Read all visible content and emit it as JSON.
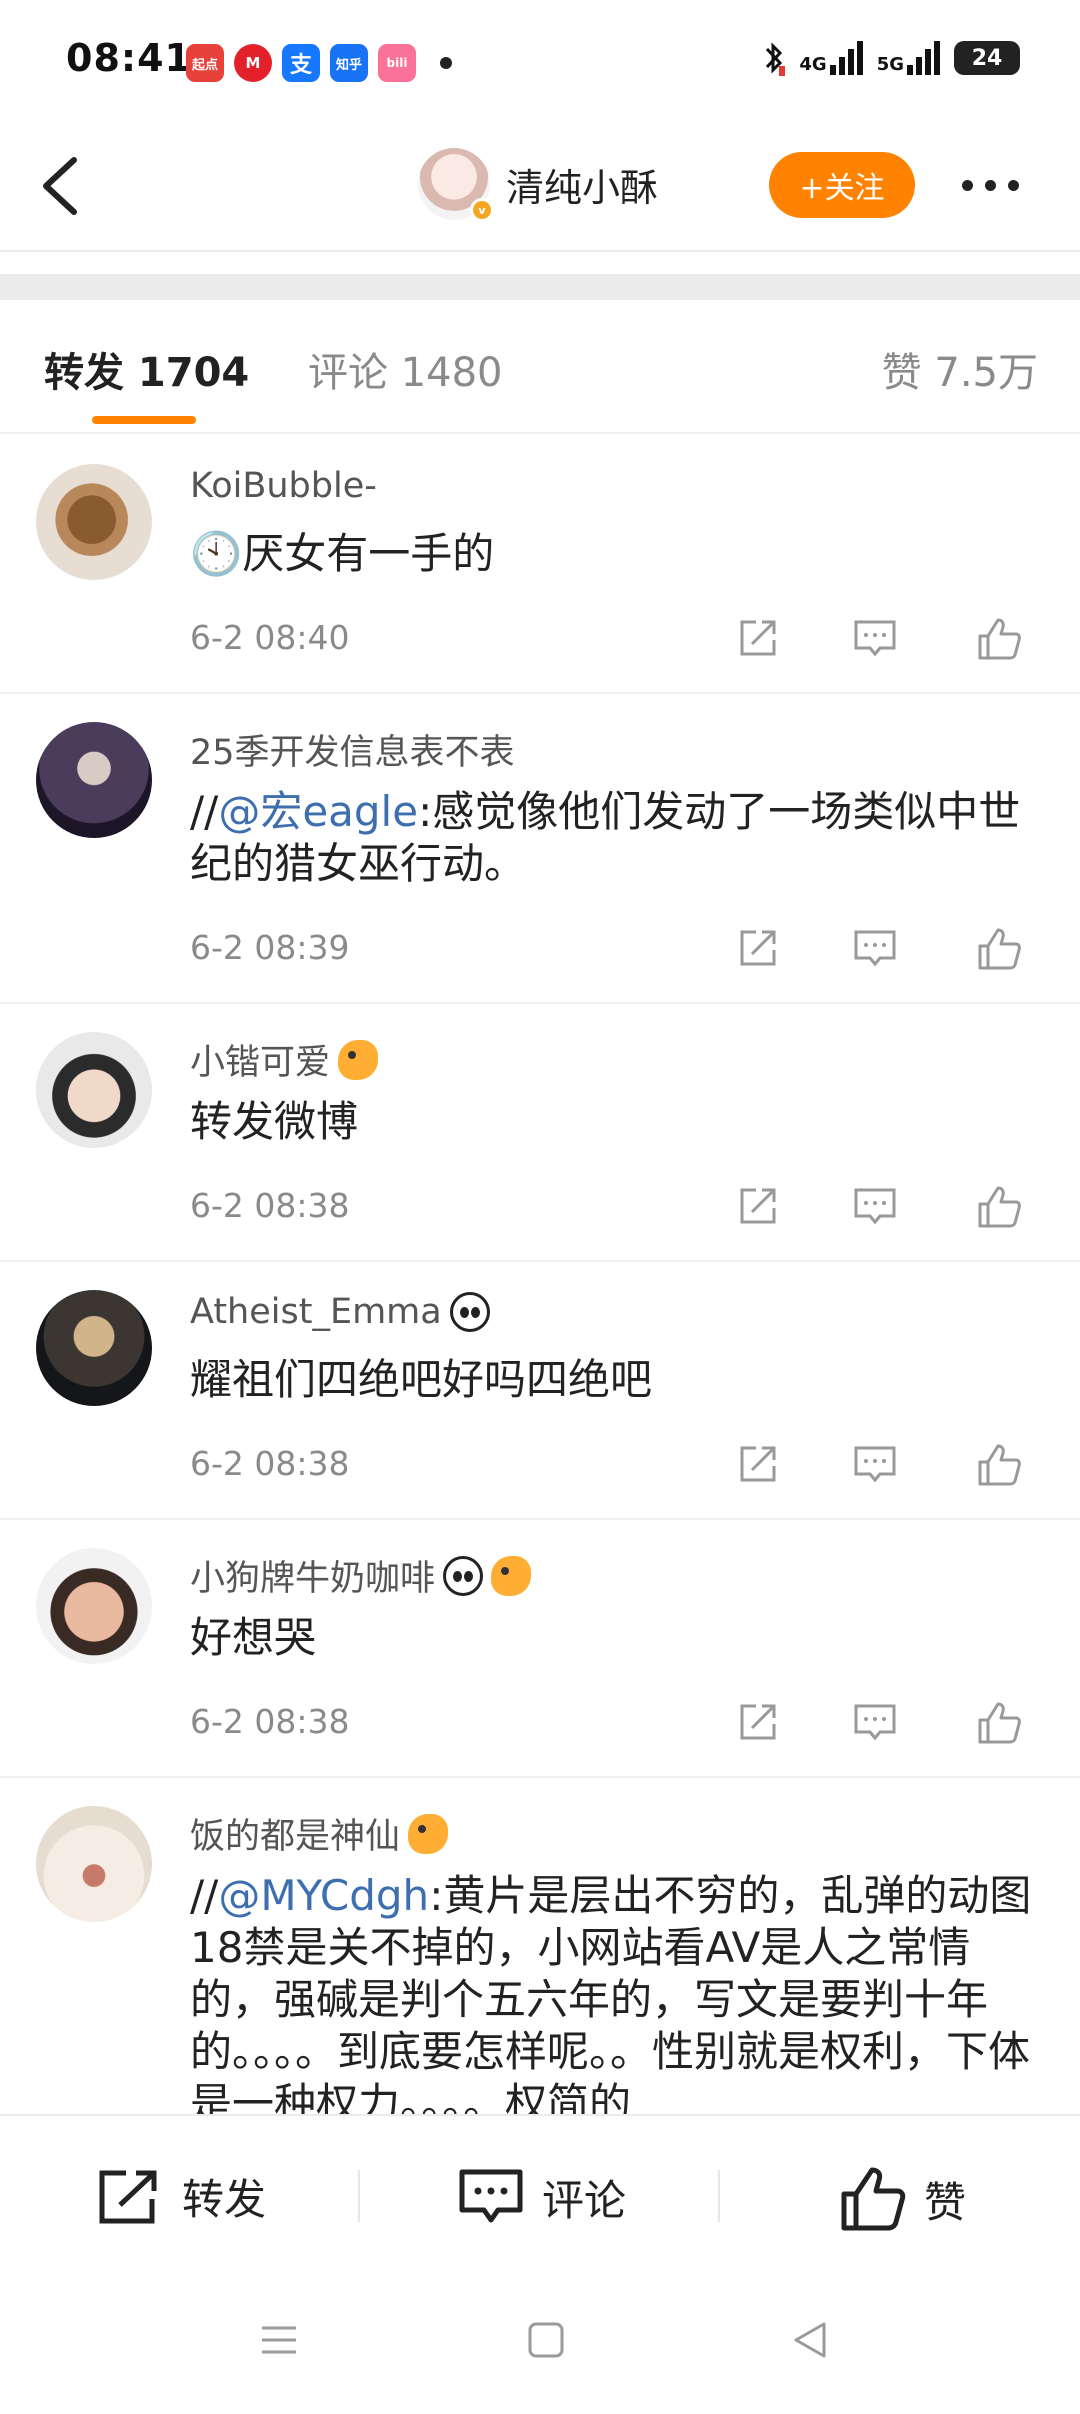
{
  "status_bar": {
    "time": "08:41",
    "app_icons": [
      {
        "name": "qidian-icon",
        "label": "起点",
        "color": "#e8403a"
      },
      {
        "name": "metro-icon",
        "label": "M",
        "color": "#e4202a"
      },
      {
        "name": "alipay-icon",
        "label": "支",
        "color": "#1677ff"
      },
      {
        "name": "zhihu-icon",
        "label": "知乎",
        "color": "#1772f6"
      },
      {
        "name": "bilibili-icon",
        "label": "bili",
        "color": "#fb7299"
      }
    ],
    "network_1": "4G",
    "network_2": "5G",
    "battery": "24"
  },
  "nav": {
    "title": "清纯小酥",
    "follow_label": "+关注"
  },
  "tabs": {
    "repost": "转发 1704",
    "comment": "评论 1480",
    "like": "赞 7.5万"
  },
  "reposts": [
    {
      "user": "KoiBubble-",
      "content_parts": [
        "🕙厌女有一手的"
      ],
      "time": "6-2 08:40",
      "badges": []
    },
    {
      "user": "25季开发信息表不表",
      "content_parts": [
        "//",
        "@宏eagle",
        ":感觉像他们发动了一场类似中世纪的猎女巫行动。"
      ],
      "time": "6-2 08:39",
      "badges": []
    },
    {
      "user": "小锴可爱",
      "content_parts": [
        "转发微博"
      ],
      "time": "6-2 08:38",
      "badges": [
        "fish"
      ]
    },
    {
      "user": "Atheist_Emma",
      "content_parts": [
        "耀祖们四绝吧好吗四绝吧"
      ],
      "time": "6-2 08:38",
      "badges": [
        "panda"
      ]
    },
    {
      "user": "小狗牌牛奶咖啡",
      "content_parts": [
        "好想哭"
      ],
      "time": "6-2 08:38",
      "badges": [
        "panda",
        "fish"
      ]
    },
    {
      "user": "饭的都是神仙",
      "content_parts": [
        "//",
        "@MYCdgh",
        ":黄片是层出不穷的，乱弹的动图18禁是关不掉的，小网站看AV是人之常情的，强碱是判个五六年的，写文是要判十年的。。。。到底要怎样呢。。性别就是权利，下体是一种权力。。。。权简的"
      ],
      "time": "",
      "badges": [
        "fish"
      ]
    }
  ],
  "bottom_bar": {
    "repost": "转发",
    "comment": "评论",
    "like": "赞"
  },
  "colors": {
    "accent": "#ff8200",
    "mention": "#3d6fb0",
    "muted": "#8a8a8a"
  }
}
